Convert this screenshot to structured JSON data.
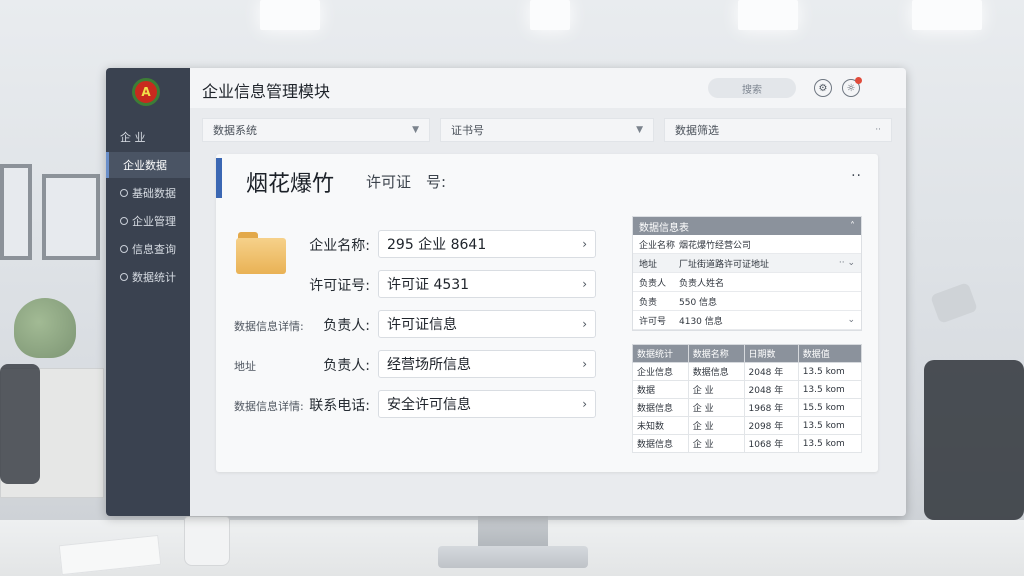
{
  "app": {
    "title": "企业信息管理模块",
    "search_placeholder": "搜索",
    "logo_text": "A"
  },
  "sidebar": {
    "items": [
      {
        "label": "企 业"
      },
      {
        "label": "企业数据"
      },
      {
        "label": "基础数据"
      },
      {
        "label": "企业管理"
      },
      {
        "label": "信息查询"
      },
      {
        "label": "数据统计"
      }
    ]
  },
  "filters": [
    {
      "label": "数据系统"
    },
    {
      "label": "证书号"
    },
    {
      "label": "数据筛选"
    }
  ],
  "card": {
    "title": "烟花爆竹",
    "subtitle": "许可证　号:",
    "more": "··"
  },
  "form": {
    "rows": [
      {
        "side": "",
        "label": "企业名称:",
        "value": "295 企业 8641"
      },
      {
        "side": "",
        "label": "许可证号:",
        "value": "许可证 4531"
      },
      {
        "side": "数据信息详情:",
        "label": "负责人:",
        "value": "许可证信息"
      },
      {
        "side": "地址",
        "label": "负责人:",
        "value": "经营场所信息"
      },
      {
        "side": "数据信息详情:",
        "label": "联系电话:",
        "value": "安全许可信息"
      }
    ]
  },
  "info_panel": {
    "title": "数据信息表",
    "rows": [
      {
        "k": "企业名称",
        "v": "烟花爆竹经营公司",
        "e": ""
      },
      {
        "k": "地址",
        "v": "厂址街道路许可证地址",
        "e": "··"
      },
      {
        "k": "负责人",
        "v": "负责人姓名",
        "e": ""
      },
      {
        "k": "负责",
        "v": "550 信息",
        "e": ""
      },
      {
        "k": "许可号",
        "v": "4130 信息",
        "e": ""
      }
    ]
  },
  "stats_table": {
    "headers": [
      "数据统计",
      "数据名称",
      "日期数",
      "数据值"
    ],
    "rows": [
      [
        "企业信息",
        "数据信息",
        "2048 年",
        "13.5 kom"
      ],
      [
        "数据",
        "企 业",
        "2048 年",
        "13.5 kom"
      ],
      [
        "数据信息",
        "企 业",
        "1968 年",
        "15.5 kom"
      ],
      [
        "未知数",
        "企 业",
        "2098 年",
        "13.5 kom"
      ],
      [
        "数据信息",
        "企 业",
        "1068 年",
        "13.5 kom"
      ]
    ]
  },
  "colors": {
    "sidebar_bg": "#3a4250",
    "accent_blue": "#3b67b3",
    "panel_header": "#8b929c"
  }
}
